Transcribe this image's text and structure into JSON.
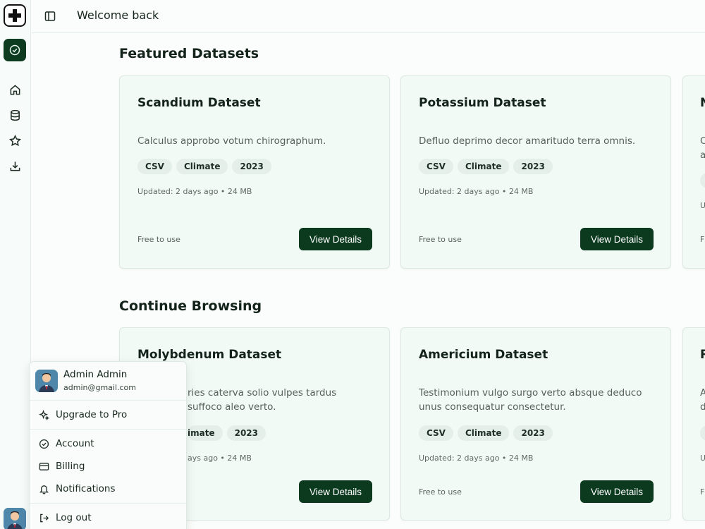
{
  "topbar": {
    "title": "Welcome back"
  },
  "sections": {
    "featured": {
      "title": "Featured Datasets",
      "cards": [
        {
          "title": "Scandium Dataset",
          "description": "Calculus approbo votum chirographum.",
          "tags": [
            "CSV",
            "Climate",
            "2023"
          ],
          "meta": "Updated: 2 days ago • 24 MB",
          "license": "Free to use",
          "button": "View Details"
        },
        {
          "title": "Potassium Dataset",
          "description": "Defluo deprimo decor amaritudo terra omnis.",
          "tags": [
            "CSV",
            "Climate",
            "2023"
          ],
          "meta": "Updated: 2 days ago • 24 MB",
          "license": "Free to use",
          "button": "View Details"
        },
        {
          "title": "N",
          "description": "C a",
          "tags": [
            ""
          ],
          "meta": "U",
          "license": "F",
          "button": ""
        }
      ]
    },
    "continue": {
      "title": "Continue Browsing",
      "cards": [
        {
          "title": "Molybdenum Dataset",
          "description": "ries caterva solio vulpes tardus suffoco aleo verto.",
          "tags": [
            "imate",
            "2023"
          ],
          "meta": "ays ago • 24 MB",
          "license": "",
          "button": "View Details"
        },
        {
          "title": "Americium Dataset",
          "description": "Testimonium vulgo surgo verto absque deduco unus consequatur consectetur.",
          "tags": [
            "CSV",
            "Climate",
            "2023"
          ],
          "meta": "Updated: 2 days ago • 24 MB",
          "license": "Free to use",
          "button": "View Details"
        },
        {
          "title": "R",
          "description": "A d",
          "tags": [
            ""
          ],
          "meta": "U",
          "license": "F",
          "button": ""
        }
      ]
    }
  },
  "user_menu": {
    "name": "Admin Admin",
    "email": "admin@gmail.com",
    "upgrade": "Upgrade to Pro",
    "account": "Account",
    "billing": "Billing",
    "notifications": "Notifications",
    "logout": "Log out"
  },
  "colors": {
    "brand": "#0b3a1f",
    "card_bg": "#f2faf6",
    "tag_bg": "#e3efe8"
  },
  "icons": [
    "plus-logo-icon",
    "check-circle-icon",
    "home-icon",
    "database-icon",
    "star-icon",
    "download-icon",
    "sidebar-toggle-icon",
    "sparkles-icon",
    "bell-icon",
    "credit-card-icon",
    "logout-icon"
  ]
}
